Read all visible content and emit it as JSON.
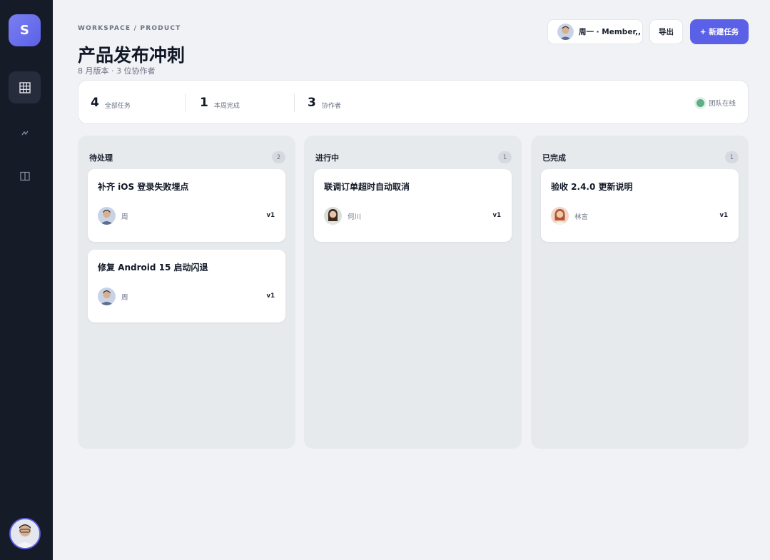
{
  "app": {
    "logo_letter": "S",
    "brand_color": "#5b61e6"
  },
  "sidebar": {
    "items": [
      {
        "name": "grid-icon",
        "active": true
      },
      {
        "name": "activity-icon",
        "active": false
      },
      {
        "name": "columns-icon",
        "active": false
      }
    ],
    "avatar": "user-avatar"
  },
  "header": {
    "breadcrumb": "WORKSPACE / PRODUCT",
    "title": "产品发布冲刺",
    "subtitle": "8 月版本 · 3 位协作者",
    "user_label": "周一 · Member,,",
    "export_label": "导出",
    "new_task_label": "+ 新建任务"
  },
  "stats": [
    {
      "value": "4",
      "label": "全部任务"
    },
    {
      "value": "1",
      "label": "本周完成"
    },
    {
      "value": "3",
      "label": "协作者"
    }
  ],
  "team_status": {
    "label": "团队在线",
    "color": "#5fae88"
  },
  "columns": [
    {
      "title": "待处理",
      "count": "2",
      "cards": [
        {
          "title": "补齐 iOS 登录失败埋点",
          "assignee": "周",
          "version": "v1"
        },
        {
          "title": "修复 Android 15 启动闪退",
          "assignee": "周",
          "version": "v1"
        }
      ]
    },
    {
      "title": "进行中",
      "count": "1",
      "cards": [
        {
          "title": "联调订单超时自动取消",
          "assignee": "何川",
          "version": "v1"
        }
      ]
    },
    {
      "title": "已完成",
      "count": "1",
      "cards": [
        {
          "title": "验收 2.4.0 更新说明",
          "assignee": "林言",
          "version": "v1"
        }
      ]
    }
  ]
}
